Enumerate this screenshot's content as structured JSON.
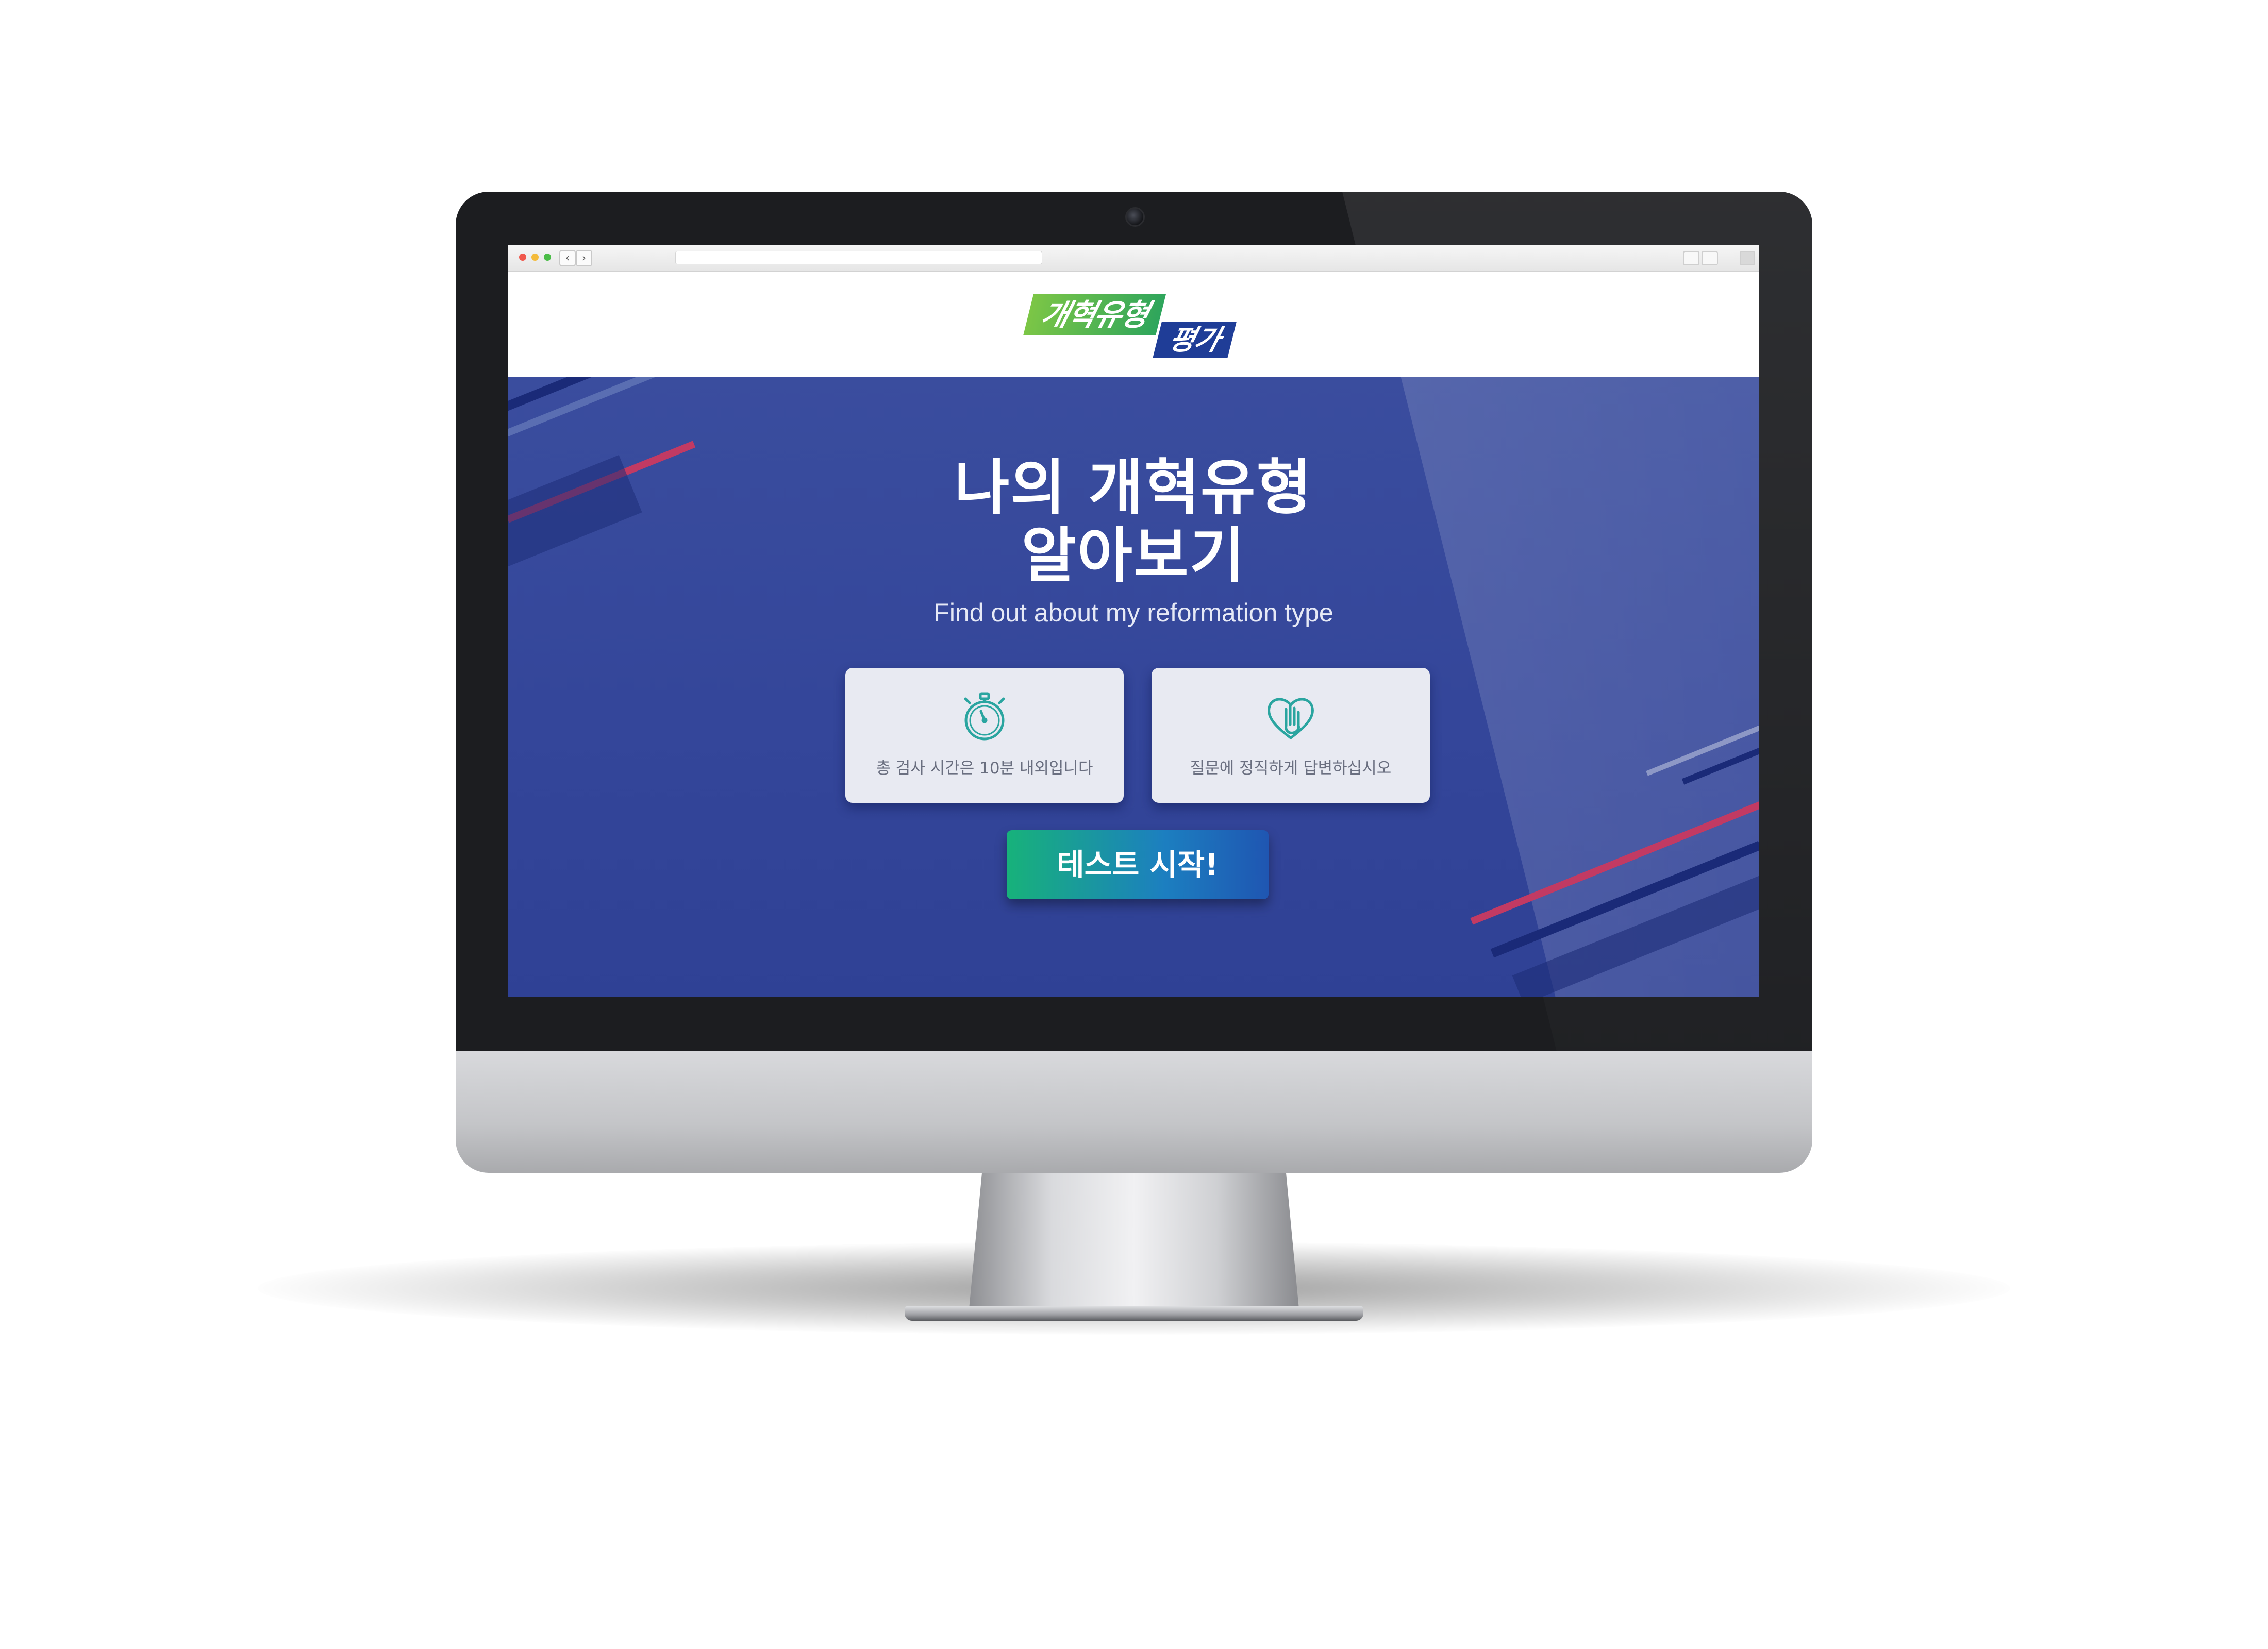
{
  "header": {
    "logo_part1": "개혁유형",
    "logo_part2": "평가"
  },
  "hero": {
    "title_line1": "나의 개혁유형",
    "title_line2": "알아보기",
    "subtitle": "Find out about my reformation type"
  },
  "cards": [
    {
      "icon": "stopwatch-icon",
      "text": "총 검사 시간은 10분 내외입니다"
    },
    {
      "icon": "heart-hand-icon",
      "text": "질문에 정직하게 답변하십시오"
    }
  ],
  "cta": {
    "label": "테스트 시작!"
  },
  "browser": {
    "nav_back_glyph": "‹",
    "nav_forward_glyph": "›"
  },
  "colors": {
    "hero_background": "#34469a",
    "logo_green": "#2ea55c",
    "logo_blue": "#1f3d97",
    "card_background": "#e8eaf2",
    "card_icon": "#2aa5a0",
    "button_gradient_start": "#17b27a",
    "button_gradient_end": "#1f56b2",
    "stripe_red": "#c23a63",
    "stripe_navy": "#1a2a78"
  }
}
